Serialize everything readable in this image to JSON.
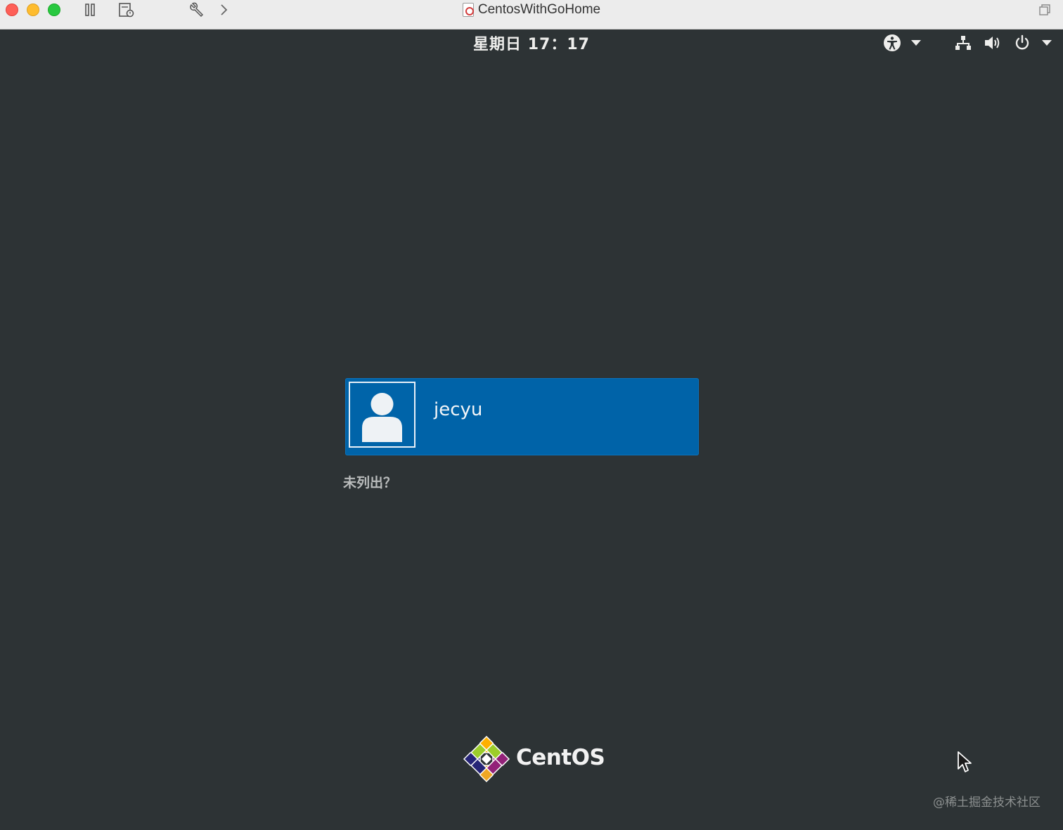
{
  "window": {
    "title": "CentosWithGoHome"
  },
  "topbar": {
    "clock": "星期日 17：17"
  },
  "login": {
    "user": {
      "name": "jecyu"
    },
    "not_listed": "未列出？"
  },
  "logo": {
    "text": "CentOS"
  },
  "watermark": "@稀土掘金技术社区",
  "colors": {
    "background": "#2d3335",
    "selected_user": "#0063a8",
    "titlebar": "#ececec"
  },
  "icons": {
    "titlebar": [
      "pause-icon",
      "snapshot-icon",
      "wrench-icon",
      "chevron-right-icon",
      "window-restore-icon"
    ],
    "tray": [
      "accessibility-icon",
      "dropdown-arrow-icon",
      "network-icon",
      "volume-icon",
      "power-icon",
      "dropdown-arrow-icon"
    ]
  }
}
